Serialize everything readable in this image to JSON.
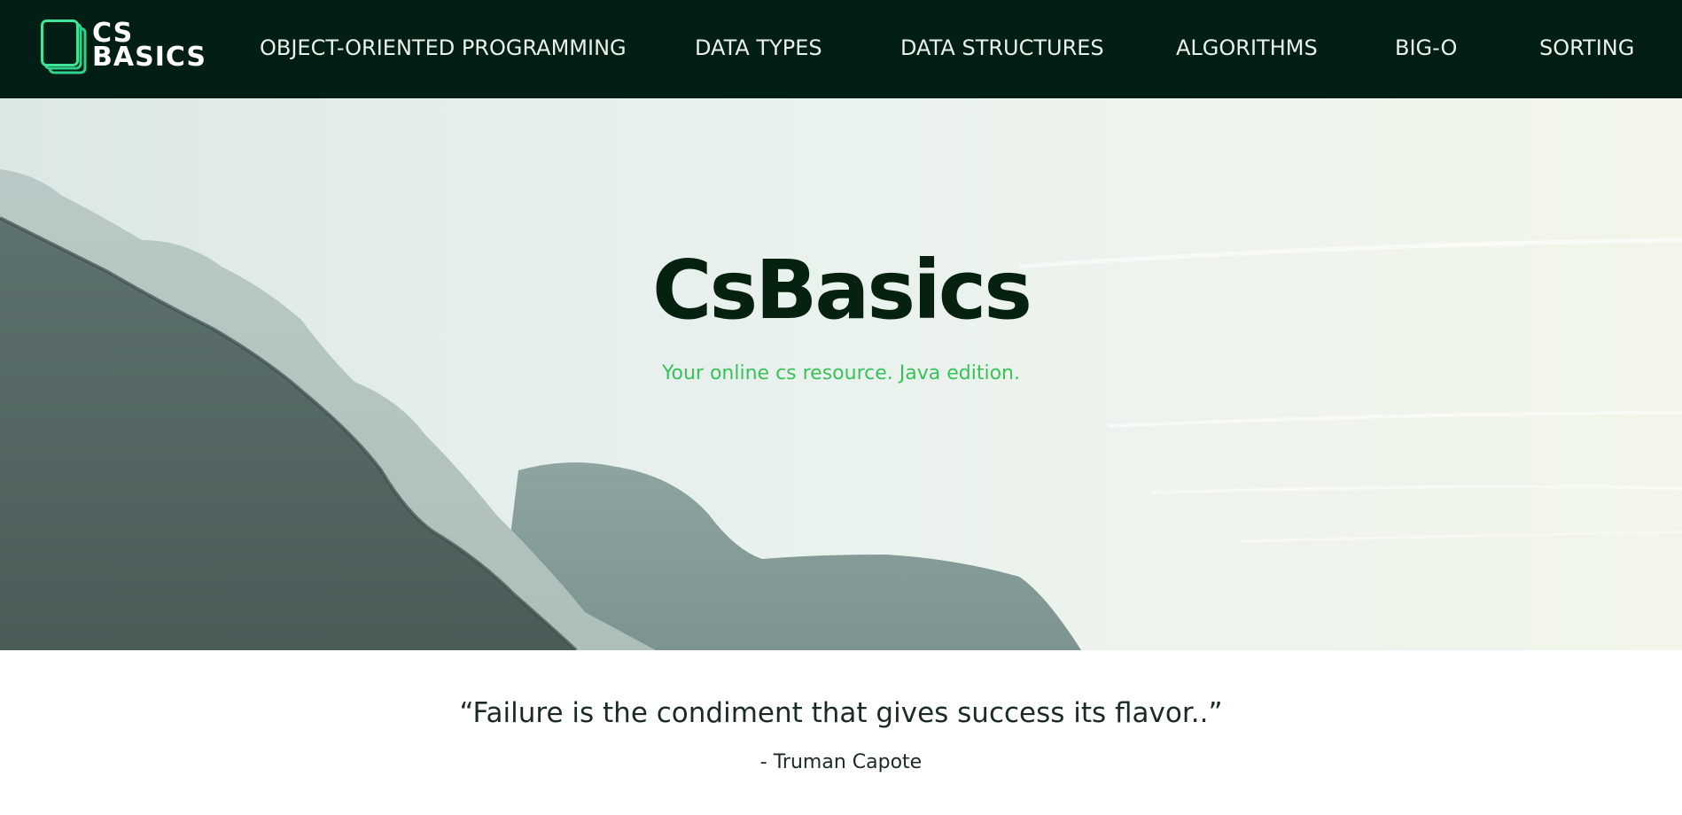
{
  "header": {
    "logo": {
      "line1": "CS",
      "line2": "BASICS",
      "icon": "stacked-pages-logo-icon",
      "accent_color": "#2fd38a"
    },
    "nav": [
      {
        "label": "OBJECT-ORIENTED PROGRAMMING"
      },
      {
        "label": "DATA TYPES"
      },
      {
        "label": "DATA STRUCTURES"
      },
      {
        "label": "ALGORITHMS"
      },
      {
        "label": "BIG-O"
      },
      {
        "label": "SORTING"
      }
    ],
    "background_color": "#031e14"
  },
  "hero": {
    "title": "CsBasics",
    "subtitle": "Your online cs resource. Java edition.",
    "subtitle_color": "#39c25a",
    "background_image": "misty-mountains"
  },
  "quote": {
    "text": "“Failure is the condiment that gives success its flavor..”",
    "author": "- Truman Capote"
  }
}
